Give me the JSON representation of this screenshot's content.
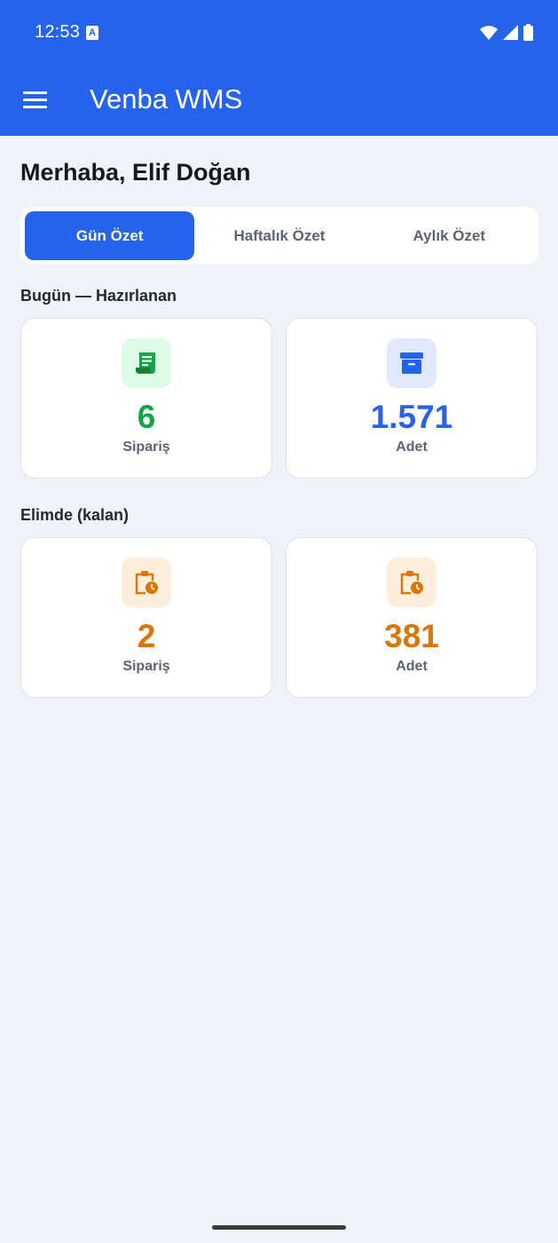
{
  "status_bar": {
    "time": "12:53",
    "a_badge": "A"
  },
  "app_bar": {
    "title": "Venba WMS"
  },
  "greeting": "Merhaba, Elif Doğan",
  "tabs": [
    {
      "label": "Gün Özet",
      "active": true
    },
    {
      "label": "Haftalık Özet",
      "active": false
    },
    {
      "label": "Aylık Özet",
      "active": false
    }
  ],
  "sections": [
    {
      "title": "Bugün — Hazırlanan",
      "cards": [
        {
          "icon": "receipt-icon",
          "value": "6",
          "label": "Sipariş",
          "color": "#16a34a",
          "icon_bg": "#dcfce7"
        },
        {
          "icon": "archive-box-icon",
          "value": "1.571",
          "label": "Adet",
          "color": "#2563eb",
          "icon_bg": "#e0e9fe"
        }
      ]
    },
    {
      "title": "Elimde (kalan)",
      "cards": [
        {
          "icon": "clipboard-clock-icon",
          "value": "2",
          "label": "Sipariş",
          "color": "#d97706",
          "icon_bg": "#fdeedc"
        },
        {
          "icon": "clipboard-clock-icon",
          "value": "381",
          "label": "Adet",
          "color": "#d97706",
          "icon_bg": "#fdeedc"
        }
      ]
    }
  ],
  "colors": {
    "primary": "#2563eb",
    "background": "#f0f3f9"
  }
}
